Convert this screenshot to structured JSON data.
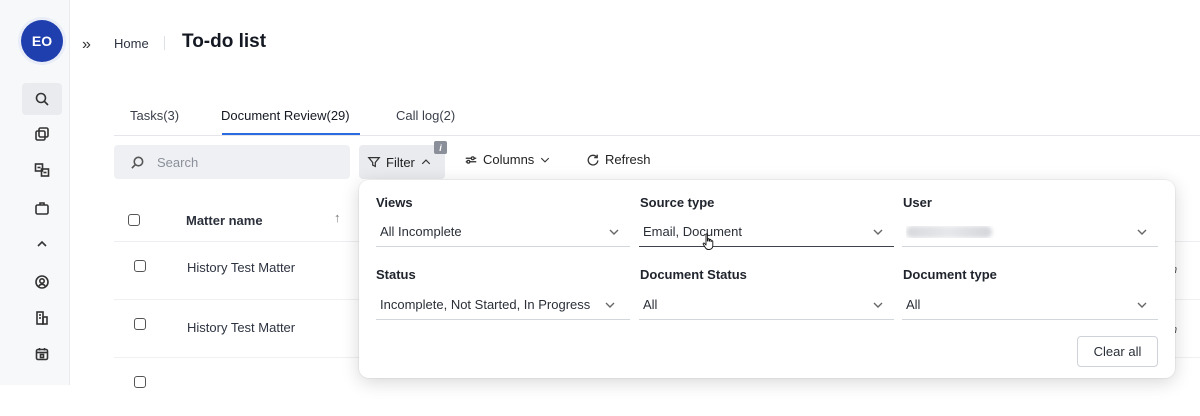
{
  "sidebar": {
    "avatar_initials": "EO",
    "icons": [
      "search-icon",
      "copy-icon",
      "translate-icon",
      "briefcase-icon",
      "chevron-up-icon",
      "user-circle-icon",
      "building-icon",
      "calendar-icon"
    ]
  },
  "header": {
    "expand_glyph": "»",
    "breadcrumb_home": "Home",
    "title": "To-do list"
  },
  "tabs": [
    {
      "label": "Tasks(3)"
    },
    {
      "label": "Document Review(29)"
    },
    {
      "label": "Call log(2)"
    }
  ],
  "toolbar": {
    "search_placeholder": "Search",
    "filter_label": "Filter",
    "info_badge": "i",
    "columns_label": "Columns",
    "refresh_label": "Refresh"
  },
  "table": {
    "column_matter": "Matter name",
    "sort_glyph": "↑",
    "rows": [
      {
        "matter": "History Test Matter",
        "partial": "n"
      },
      {
        "matter": "History Test Matter",
        "partial": "n"
      }
    ]
  },
  "filter_panel": {
    "views": {
      "label": "Views",
      "value": "All Incomplete"
    },
    "source_type": {
      "label": "Source type",
      "value": "Email, Document"
    },
    "user": {
      "label": "User",
      "value": ""
    },
    "status": {
      "label": "Status",
      "value": "Incomplete, Not Started, In Progress"
    },
    "document_status": {
      "label": "Document Status",
      "value": "All"
    },
    "document_type": {
      "label": "Document type",
      "value": "All"
    },
    "clear_all_label": "Clear all"
  },
  "colors": {
    "avatar_bg": "#1f3fae",
    "accent": "#2b6be0",
    "sidebar_bg": "#f7f8fa"
  }
}
